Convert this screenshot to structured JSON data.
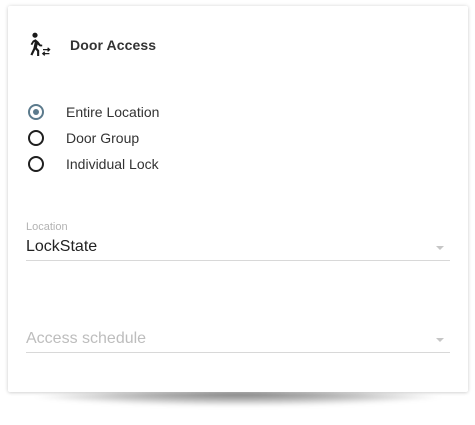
{
  "header": {
    "icon": "door-access-icon",
    "title": "Door Access"
  },
  "access_scope": {
    "options": [
      {
        "label": "Entire Location",
        "checked": true
      },
      {
        "label": "Door Group",
        "checked": false
      },
      {
        "label": "Individual Lock",
        "checked": false
      }
    ]
  },
  "location": {
    "caption": "Location",
    "value": "LockState"
  },
  "schedule": {
    "placeholder": "Access schedule"
  },
  "colors": {
    "radio_selected": "#5b7a8c",
    "text": "#333333",
    "muted": "#bdbdbd"
  }
}
